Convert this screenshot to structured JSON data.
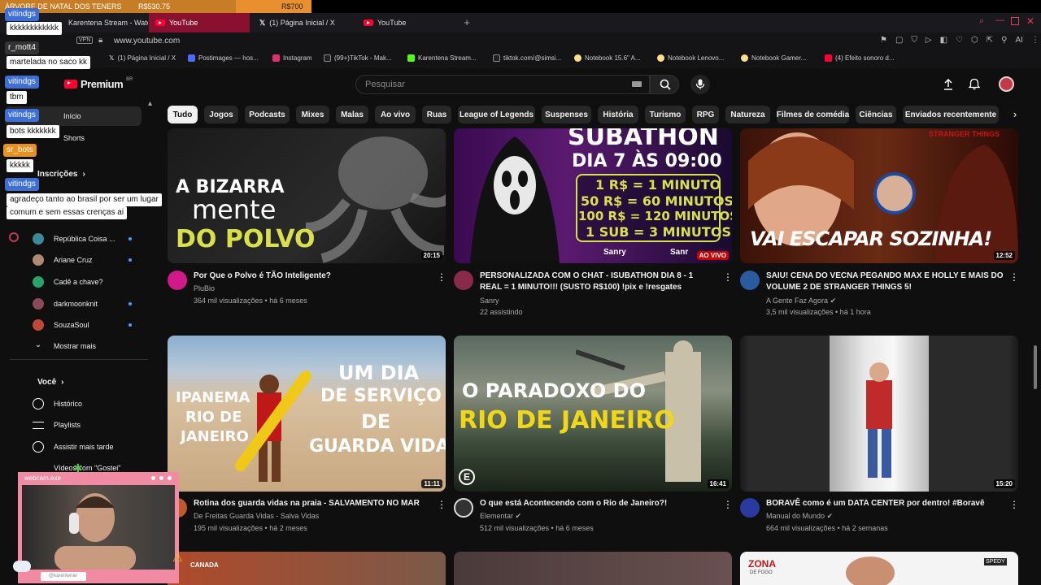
{
  "donation": {
    "title": "ÁRVORE DE NATAL DOS TENERS",
    "current": "R$530.75",
    "goal": "R$700",
    "progress": 0.758
  },
  "browser": {
    "tabs": [
      {
        "label": "Karentena Stream - Watc"
      },
      {
        "label": "YouTube"
      },
      {
        "label": "(1) Página Inicial / X"
      },
      {
        "label": "YouTube"
      }
    ],
    "vpn_label": "VPN",
    "url": "www.youtube.com",
    "ai_label": "AI",
    "bookmarks": [
      {
        "label": "(1) Página Inicial / X",
        "color": "#ffffff"
      },
      {
        "label": "Postimages — hos...",
        "color": "#4a6cff"
      },
      {
        "label": "Instagram",
        "color": "#e1306c"
      },
      {
        "label": "(99+)TikTok - Mak...",
        "color": "#ffffff"
      },
      {
        "label": "Karentena Stream...",
        "color": "#53fc18"
      },
      {
        "label": "tiktok.com/@simsi...",
        "color": "#ffffff"
      },
      {
        "label": "Notebook 15.6\" A...",
        "color": "#ffe08a"
      },
      {
        "label": "Notebook Lenovo...",
        "color": "#ffe08a"
      },
      {
        "label": "Notebook Gamer...",
        "color": "#ffe08a"
      },
      {
        "label": "(4) Efeito sonoro d...",
        "color": "#ff0033"
      }
    ]
  },
  "header": {
    "logo_text": "Premium",
    "logo_region": "BR",
    "search_placeholder": "Pesquisar",
    "avatar_color": "#c23a4a"
  },
  "chips": [
    {
      "label": "Tudo",
      "selected": true
    },
    {
      "label": "Jogos"
    },
    {
      "label": "Podcasts"
    },
    {
      "label": "Mixes"
    },
    {
      "label": "Malas"
    },
    {
      "label": "Ao vivo"
    },
    {
      "label": "Ruas"
    },
    {
      "label": "League of Legends"
    },
    {
      "label": "Suspenses"
    },
    {
      "label": "História"
    },
    {
      "label": "Turismo"
    },
    {
      "label": "RPG"
    },
    {
      "label": "Natureza"
    },
    {
      "label": "Filmes de comédia"
    },
    {
      "label": "Ciências"
    },
    {
      "label": "Enviados recentemente"
    }
  ],
  "sidebar": {
    "home": "Início",
    "shorts": "Shorts",
    "subscriptions": "Inscrições",
    "channels": [
      {
        "name": "República Coisa ...",
        "color": "#3a8a9a",
        "live": true
      },
      {
        "name": "Ariane Cruz",
        "color": "#b08a70",
        "live": true
      },
      {
        "name": "Cadê a chave?",
        "color": "#2aa36a",
        "live": false
      },
      {
        "name": "darkmoonknit",
        "color": "#8a4a5a",
        "live": true
      },
      {
        "name": "SouzaSoul",
        "color": "#c0483a",
        "live": true
      }
    ],
    "show_more": "Mostrar mais",
    "you": "Você",
    "history": "Histórico",
    "playlists": "Playlists",
    "watch_later": "Assistir mais tarde",
    "liked": "Vídeos com \"Gostei\""
  },
  "chat": [
    {
      "user": "vitindgs",
      "msg": "kkkkkkkkkkkk",
      "color": "#3d6fd6"
    },
    {
      "user": "r_mott4",
      "msg": "martelada no saco kk",
      "color": "#2a2a2a"
    },
    {
      "user": "vitindgs",
      "msg": "tbm",
      "color": "#3d6fd6"
    },
    {
      "user": "vitindgs",
      "msg": "bots kkkkkkk",
      "color": "#3d6fd6"
    },
    {
      "user": "sr_bots",
      "msg": "kkkkk",
      "color": "#e89020"
    },
    {
      "user": "vitindgs",
      "msg": "agradeço tanto ao brasil por ser um lugar",
      "msg2": "comum e sem essas crenças ai",
      "color": "#3d6fd6"
    }
  ],
  "videos": [
    {
      "title": "Por Que o Polvo é TÃO Inteligente?",
      "channel": "PluBio",
      "meta": "364 mil visualizações • há 6 meses",
      "duration": "20:15",
      "thumb_lines": [
        "A BIZARRA",
        "mente",
        "DO POLVO"
      ],
      "avatar_color": "#d01a8a",
      "verified": false
    },
    {
      "title": "PERSONALIZADA COM O CHAT - ISUBATHON DIA 8 - 1 REAL = 1 MINUTO!!! (SUSTO R$100) !pix e !resgates",
      "channel": "Sanry",
      "meta": "22 assistindo",
      "duration": "AO VIVO",
      "thumb_lines": [
        "SUBATHON",
        "DIA 7 ÀS 09:00",
        "1 R$ = 1 MINUTO",
        "50 R$ = 60 MINUTOS",
        "100 R$ = 120 MINUTOS",
        "1 SUB = 3 MINUTOS",
        "Sanry",
        "Sanr"
      ],
      "avatar_color": "#8a2a4a",
      "verified": false
    },
    {
      "title": "SAIU! CENA DO VECNA PEGANDO MAX E HOLLY E MAIS DO VOLUME 2 DE STRANGER THINGS 5!",
      "channel": "A Gente Faz Agora",
      "meta": "3,5 mil visualizações • há 1 hora",
      "duration": "12:52",
      "thumb_lines": [
        "VAI ESCAPAR SOZINHA!",
        "STRANGER THINGS"
      ],
      "avatar_color": "#2a5aa0",
      "verified": true
    },
    {
      "title": "Rotina dos guarda vidas na praia - SALVAMENTO NO MAR",
      "channel": "De Freitas Guarda Vidas - Salva Vidas",
      "meta": "195 mil visualizações • há 2 meses",
      "duration": "11:11",
      "thumb_lines": [
        "IPANEMA",
        "RIO DE",
        "JANEIRO",
        "UM DIA",
        "DE SERVIÇO",
        "DE",
        "GUARDA VIDAS"
      ],
      "avatar_color": "#c05a2a",
      "verified": false
    },
    {
      "title": "O que está Acontecendo com o Rio de Janeiro?!",
      "channel": "Elementar",
      "meta": "512 mil visualizações • há 6 meses",
      "duration": "16:41",
      "thumb_lines": [
        "O PARADOXO DO",
        "RIO DE JANEIRO"
      ],
      "avatar_color": "#333333",
      "verified": true
    },
    {
      "title": "BORAVÊ como é um DATA CENTER por dentro! #Boravê",
      "channel": "Manual do Mundo",
      "meta": "664 mil visualizações • há 2 semanas",
      "duration": "15:20",
      "thumb_lines": [],
      "avatar_color": "#2a3aa0",
      "verified": true
    }
  ],
  "bottom_row": {
    "zona_label": "ZONA",
    "zona_sub": "DE FOGO",
    "canada": "CANADA",
    "badge": "SPEDY"
  },
  "webcam": {
    "title": "webcam.exe",
    "handle": "@karentenar"
  }
}
